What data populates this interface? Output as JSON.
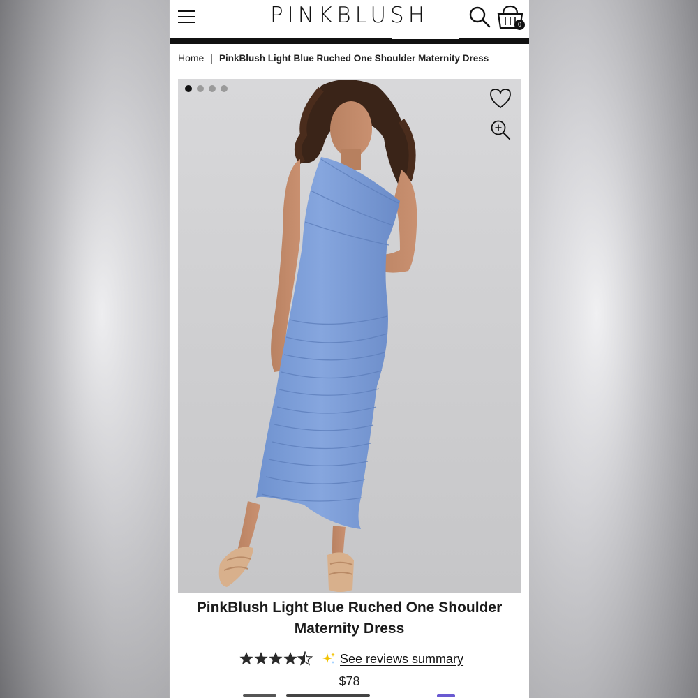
{
  "header": {
    "brand": "PINKBLUSH",
    "cart_count": "0"
  },
  "breadcrumb": {
    "home": "Home",
    "separator": "|",
    "current": "PinkBlush Light Blue Ruched One Shoulder Maternity Dress"
  },
  "gallery": {
    "total_images": 4,
    "active_index": 0,
    "icons": [
      "heart-icon",
      "zoom-in-icon"
    ]
  },
  "product": {
    "title": "PinkBlush Light Blue Ruched One Shoulder Maternity Dress",
    "rating": 4.5,
    "rating_max": 5,
    "reviews_link": "See reviews summary",
    "price": "$78"
  },
  "colors": {
    "dress_blue": "#7e9fd8",
    "text_dark": "#111111",
    "sparkle_yellow": "#f2c200"
  }
}
